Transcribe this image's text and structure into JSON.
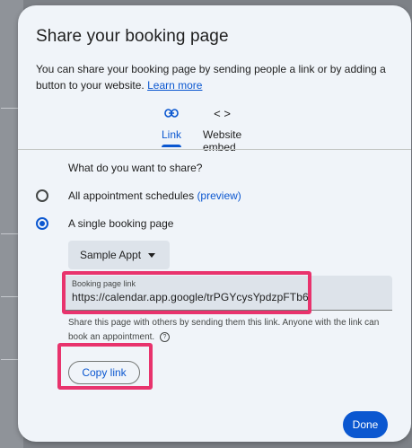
{
  "dialog": {
    "title": "Share your booking page",
    "description": "You can share your booking page by sending people a link or by adding a button to your website.",
    "learn_more": "Learn more"
  },
  "tabs": [
    {
      "label": "Link",
      "icon": "link-icon",
      "active": true
    },
    {
      "label": "Website embed",
      "icon": "code-icon",
      "active": false
    }
  ],
  "share": {
    "question": "What do you want to share?",
    "options": [
      {
        "label": "All appointment schedules",
        "link_text": "(preview)",
        "selected": false
      },
      {
        "label": "A single booking page",
        "selected": true
      }
    ],
    "selected_page": "Sample Appt",
    "field_label": "Booking page link",
    "field_value": "https://calendar.app.google/trPGYcysYpdzpFTb6",
    "helper_text": "Share this page with others by sending them this link. Anyone with the link can book an appointment.",
    "copy_label": "Copy link"
  },
  "done_label": "Done",
  "colors": {
    "accent": "#0b57d0",
    "highlight": "#e8336d",
    "dialog_bg": "#f0f4f9"
  }
}
